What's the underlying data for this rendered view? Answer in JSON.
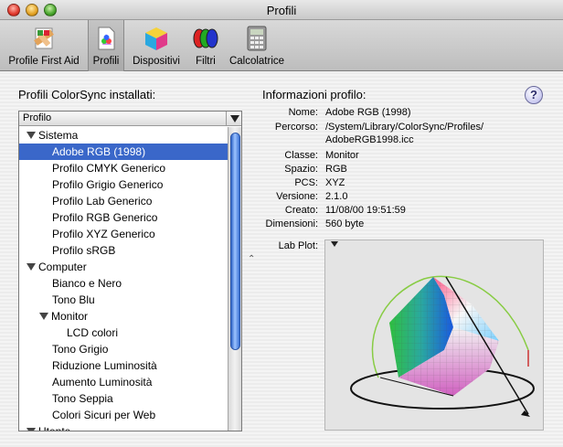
{
  "window": {
    "title": "Profili"
  },
  "toolbar": {
    "items": [
      {
        "label": "Profile First Aid",
        "icon": "first-aid-icon"
      },
      {
        "label": "Profili",
        "icon": "profiles-icon",
        "selected": true
      },
      {
        "label": "Dispositivi",
        "icon": "devices-cube-icon"
      },
      {
        "label": "Filtri",
        "icon": "filters-icon"
      },
      {
        "label": "Calcolatrice",
        "icon": "calculator-icon"
      }
    ]
  },
  "left": {
    "heading": "Profili ColorSync installati:",
    "list_header": "Profilo",
    "items": [
      {
        "label": "Sistema",
        "level": 0,
        "group": true
      },
      {
        "label": "Adobe RGB (1998)",
        "level": 1,
        "selected": true
      },
      {
        "label": "Profilo CMYK Generico",
        "level": 1
      },
      {
        "label": "Profilo Grigio Generico",
        "level": 1
      },
      {
        "label": "Profilo Lab Generico",
        "level": 1
      },
      {
        "label": "Profilo RGB Generico",
        "level": 1
      },
      {
        "label": "Profilo XYZ Generico",
        "level": 1
      },
      {
        "label": "Profilo sRGB",
        "level": 1
      },
      {
        "label": "Computer",
        "level": 0,
        "group": true
      },
      {
        "label": "Bianco e Nero",
        "level": 1
      },
      {
        "label": "Tono Blu",
        "level": 1
      },
      {
        "label": "Monitor",
        "level": 1,
        "group": true
      },
      {
        "label": "LCD colori",
        "level": 2
      },
      {
        "label": "Tono Grigio",
        "level": 1
      },
      {
        "label": "Riduzione Luminosità",
        "level": 1
      },
      {
        "label": "Aumento Luminosità",
        "level": 1
      },
      {
        "label": "Tono Seppia",
        "level": 1
      },
      {
        "label": "Colori Sicuri per Web",
        "level": 1
      },
      {
        "label": "Utente",
        "level": 0,
        "group": true
      }
    ]
  },
  "right": {
    "heading": "Informazioni profilo:",
    "help_label": "?",
    "fields": {
      "nome_label": "Nome:",
      "nome": "Adobe RGB (1998)",
      "percorso_label": "Percorso:",
      "percorso_1": "/System/Library/ColorSync/Profiles/",
      "percorso_2": "AdobeRGB1998.icc",
      "classe_label": "Classe:",
      "classe": "Monitor",
      "spazio_label": "Spazio:",
      "spazio": "RGB",
      "pcs_label": "PCS:",
      "pcs": "XYZ",
      "versione_label": "Versione:",
      "versione": "2.1.0",
      "creato_label": "Creato:",
      "creato": "11/08/00 19:51:59",
      "dimensioni_label": "Dimensioni:",
      "dimensioni": "560 byte"
    },
    "lab_plot_label": "Lab Plot:"
  },
  "colors": {
    "selection": "#3a67c9",
    "scroll_thumb": "#3a72d6"
  }
}
